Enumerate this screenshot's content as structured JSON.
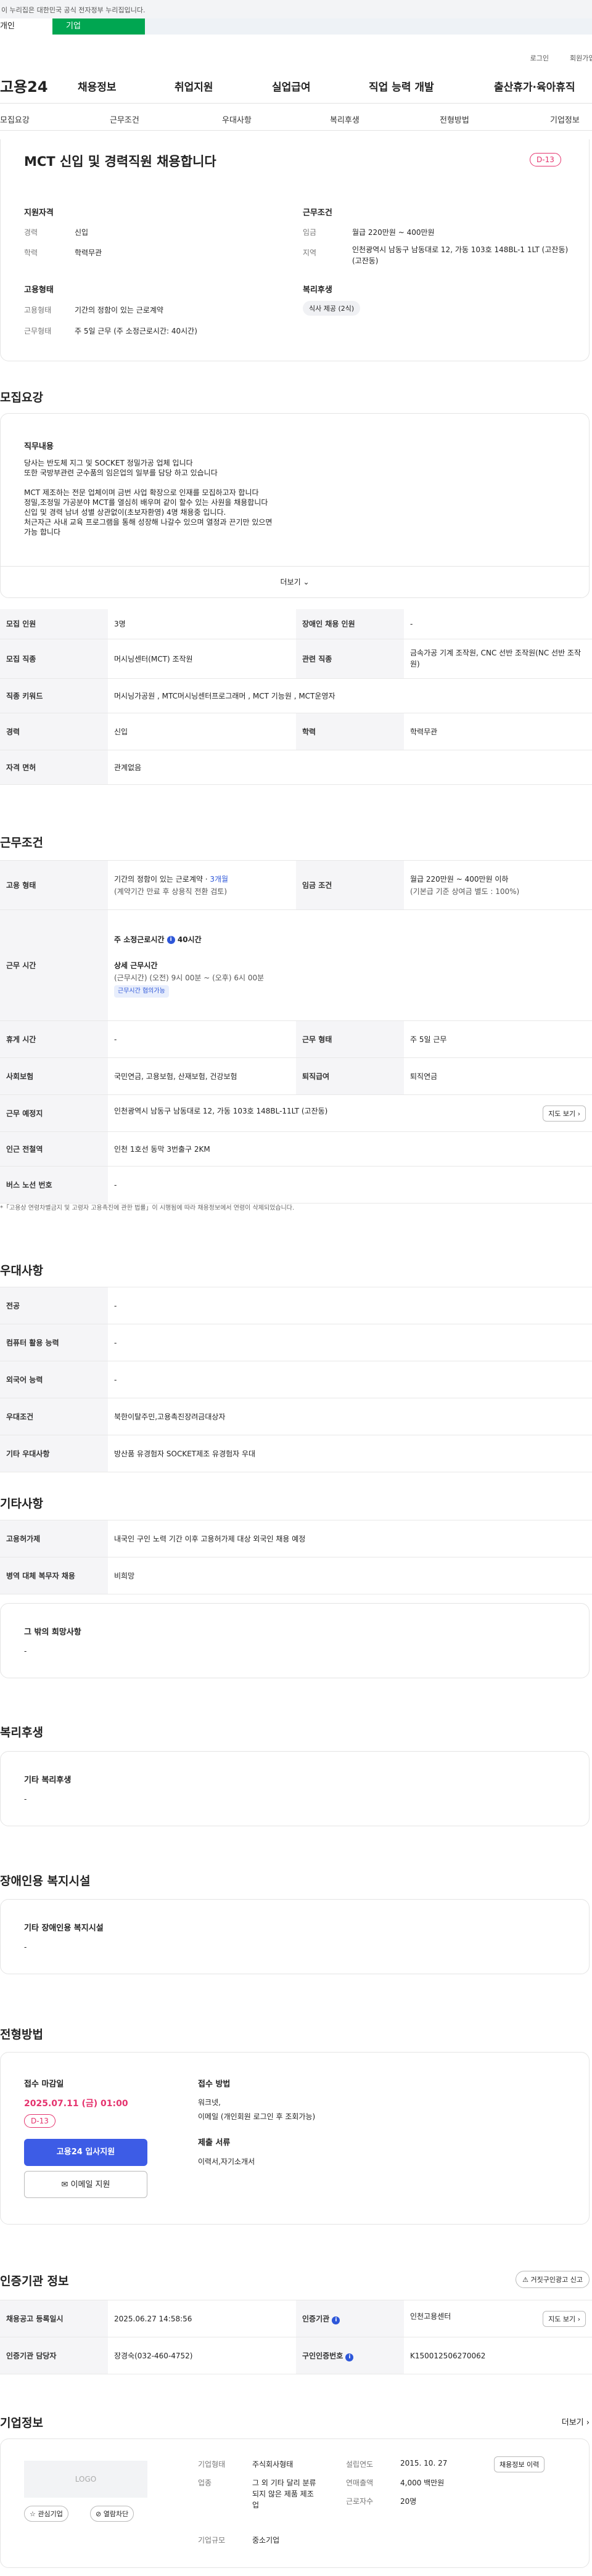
{
  "gov_banner": "이 누리집은 대한민국 공식 전자정부 누리집입니다.",
  "portal_tabs": [
    "개인",
    "기업"
  ],
  "top_links": [
    "로그인",
    "회원가입"
  ],
  "logo": "고용24",
  "gnb": [
    "채용정보",
    "취업지원",
    "실업급여",
    "직업 능력 개발",
    "출산휴가·육아휴직"
  ],
  "snb": [
    "모집요강",
    "근무조건",
    "우대사항",
    "복리후생",
    "전형방법",
    "기업정보"
  ],
  "summary": {
    "title": "MCT 신입 및 경력직원 채용합니다",
    "dday": "D-13",
    "qual_title": "지원자격",
    "career_l": "경력",
    "career_v": "신입",
    "edu_l": "학력",
    "edu_v": "학력무관",
    "cond_title": "근무조건",
    "wage_l": "임금",
    "wage_v": "월급 220만원 ~ 400만원",
    "area_l": "지역",
    "area_v": "인천광역시 남동구 남동대로 12, 가동 103호 148BL-1 1LT (고잔동) (고잔동)",
    "emp_title": "고용형태",
    "emptype_l": "고용형태",
    "emptype_v": "기간의 정함이 있는 근로계약",
    "worktype_l": "근무형태",
    "worktype_v": "주 5일 근무 (주 소정근로시간: 40시간)",
    "welfare_title": "복리후생",
    "welfare_tag": "식사 제공 (2식)"
  },
  "recruit": {
    "section": "모집요강",
    "duty_title": "직무내용",
    "duty_lines": [
      "당사는 반도체 지그 및  SOCKET 정밀가공 업체 입니다",
      "또한 국방부관련 군수품의 임은업의 일부를 담당 하고 있습니다",
      "",
      "MCT 제조하는 전문 업체이며 금번 사업 확장으로 인재를 모집하고자 합니다",
      "정밀,조정밀 가공분야 MCT를 열심히 배우며 같이 할수 있는 사원을 채용합니다",
      "신입 및 경력 남녀 성별 상관없이(초보자환영) 4명 채용중 입니다.",
      "처근자근 사내 교육 프로그램을 통해 성장해 나갈수 있으며 열정과 끈기만 있으면",
      "가능 합니다"
    ],
    "more": "더보기",
    "rows": [
      {
        "h1": "모집 인원",
        "v1": "3명",
        "h2": "장애인 채용 인원",
        "v2": "-"
      },
      {
        "h1": "모집 직종",
        "v1": "머시닝센터(MCT) 조작원",
        "h2": "관련 직종",
        "v2": "금속가공 기계 조작원, CNC 선반 조작원(NC 선반 조작원)"
      },
      {
        "h1": "직종 키워드",
        "v1": "머시닝가공원 , MTC머시닝센터프로그래머 , MCT 기능원 , MCT운영자",
        "h2": "",
        "v2": ""
      },
      {
        "h1": "경력",
        "v1": "신입",
        "h2": "학력",
        "v2": "학력무관"
      },
      {
        "h1": "자격 면허",
        "v1": "관계없음",
        "h2": "",
        "v2": ""
      }
    ]
  },
  "work": {
    "section": "근무조건",
    "emp_h": "고용 형태",
    "emp_v1": "기간의 정함이 있는 근로계약 · ",
    "emp_link": "3개월",
    "emp_v2": "(계약기간 만료 후 상용직 전환 검토)",
    "wage_h": "임금 조건",
    "wage_v1": "월급 220만원 ~ 400만원 이하",
    "wage_v2": "(기본급 기준 상여금 별도 : 100%)",
    "time_h": "근무 시간",
    "time_v1": "주 소정근로시간",
    "time_v1b": "40시간",
    "time_v2": "상세 근무시간",
    "time_v3": "(근무시간) (오전) 9시 00분 ~ (오후) 6시 00분",
    "time_btn": "근무시간 협의가능",
    "rest_h": "휴게 시간",
    "rest_v": "-",
    "form_h": "근무 형태",
    "form_v": "주 5일 근무",
    "ins_h": "사회보험",
    "ins_v": "국민연금, 고용보험, 산재보험, 건강보험",
    "ret_h": "퇴직급여",
    "ret_v": "퇴직연금",
    "place_h": "근무 예정지",
    "place_v": "인천광역시 남동구 남동대로 12, 가동 103호 148BL-11LT (고잔동)",
    "map_btn": "지도 보기",
    "sub_h": "인근 전철역",
    "sub_v": "인천 1호선 동막 3번출구 2KM",
    "bus_h": "버스 노선 번호",
    "bus_v": "-",
    "note": "*「고용상 연령차별금지 및 고령자 고용촉진에 관한 법률」이 시행됨에 따라 채용정보에서 연령이 삭제되었습니다."
  },
  "pref": {
    "section": "우대사항",
    "rows": [
      [
        "전공",
        "-"
      ],
      [
        "컴퓨터 활용 능력",
        "-"
      ],
      [
        "외국어 능력",
        "-"
      ],
      [
        "우대조건",
        "북한이탈주민,고용촉진장려금대상자"
      ],
      [
        "기타 우대사항",
        "방산품 유경험자 SOCKET제조 유경험자 우대"
      ]
    ]
  },
  "etc": {
    "section": "기타사항",
    "rows": [
      [
        "고용허가제",
        "내국인 구인 노력 기간 이후 고용허가제 대상 외국인 채용 예정"
      ],
      [
        "병역 대체 복무자 채용",
        "비희망"
      ]
    ],
    "other_title": "그 밖의 희망사항",
    "other_v": "-"
  },
  "welfare": {
    "section": "복리후생",
    "title": "기타 복리후생",
    "v": "-"
  },
  "disabled": {
    "section": "장애인용 복지시설",
    "title": "기타 장애인용 복지시설",
    "v": "-"
  },
  "selection": {
    "section": "전형방법",
    "deadline_l": "접수 마감일",
    "deadline_v": "2025.07.11 (금) 01:00",
    "dday": "D-13",
    "apply_btn": "고용24 입사지원",
    "mail_btn": "이메일 지원",
    "method_l": "접수 방법",
    "method_v1": "워크넷,",
    "method_v2": "이메일 (개인회원 로그인 후 조회가능)",
    "docs_l": "제출 서류",
    "docs_v": "이력서,자기소개서"
  },
  "cert": {
    "section": "인증기관 정보",
    "report_btn": "거짓구인광고 신고",
    "r1h1": "채용공고 등록일시",
    "r1v1": "2025.06.27 14:58:56",
    "r1h2": "인증기관",
    "r1v2": "인천고용센터",
    "map_btn": "지도 보기",
    "r2h1": "인증기관 담당자",
    "r2v1": "장경숙(032-460-4752)",
    "r2h2": "구인인증번호",
    "r2v2": "K150012506270062"
  },
  "company": {
    "section": "기업정보",
    "more": "더보기",
    "logo": "LOGO",
    "fav_btn": "관심기업",
    "block_btn": "열람차단",
    "type_l": "기업형태",
    "type_v": "주식회사형태",
    "ind_l": "업종",
    "ind_v": "그 외 기타 달리 분류되지 않은 제품 제조업",
    "scale_l": "기업규모",
    "scale_v": "중소기업",
    "est_l": "설립연도",
    "est_v": "2015. 10. 27",
    "sales_l": "연매출액",
    "sales_v": "4,000 백만원",
    "emp_l": "근로자수",
    "emp_v": "20명",
    "jobs_btn": "채용정보 이력"
  }
}
